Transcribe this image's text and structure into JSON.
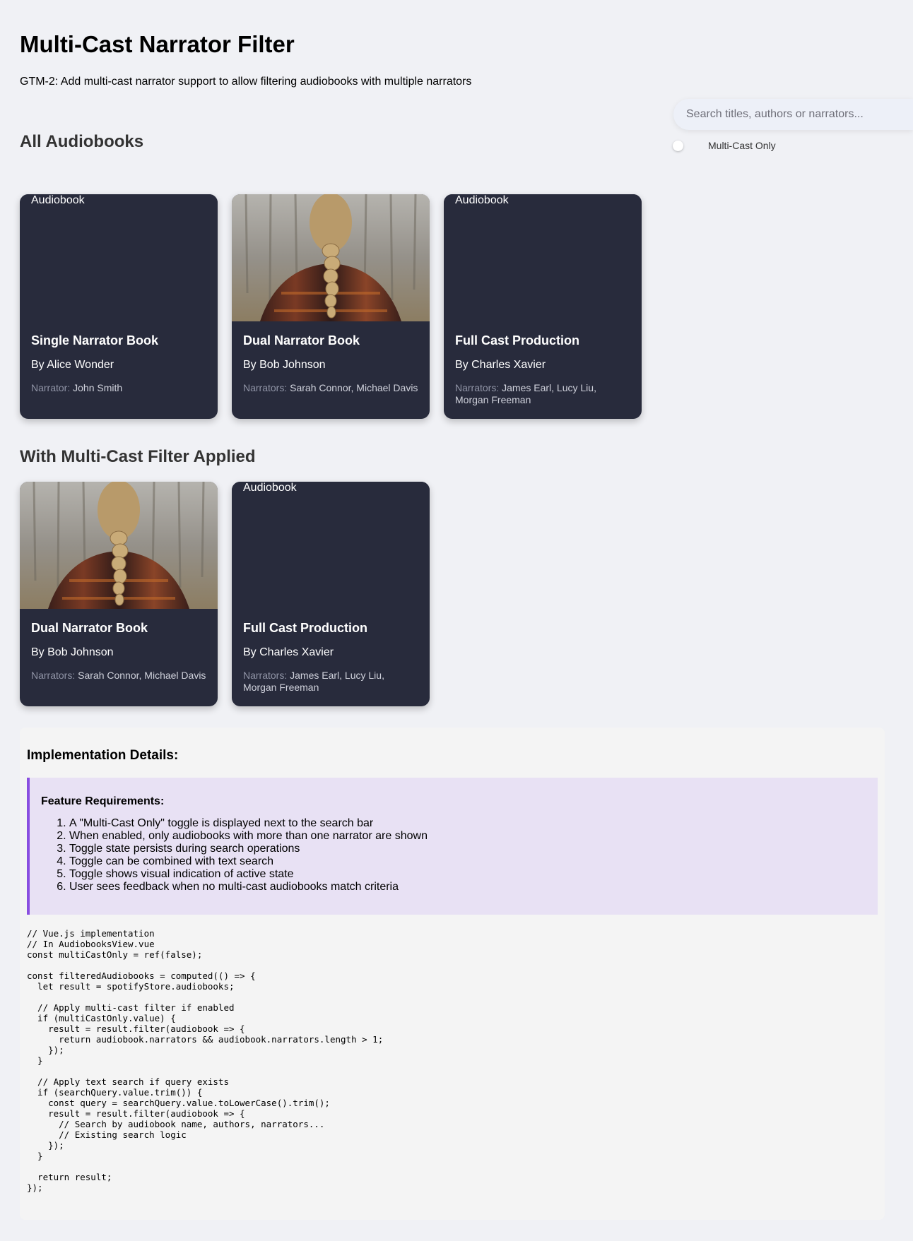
{
  "header": {
    "title": "Multi-Cast Narrator Filter",
    "subtitle": "GTM-2: Add multi-cast narrator support to allow filtering audiobooks with multiple narrators"
  },
  "search": {
    "placeholder": "Search titles, authors or narrators...",
    "value": ""
  },
  "toggle": {
    "label": "Multi-Cast Only",
    "active": false
  },
  "sections": {
    "all_heading": "All Audiobooks",
    "filtered_heading": "With Multi-Cast Filter Applied"
  },
  "all_books": [
    {
      "image_alt": "Audiobook",
      "image": "broken",
      "title": "Single Narrator Book",
      "author": "By Alice Wonder",
      "narrators_label": "Narrator:",
      "narrators": "John Smith"
    },
    {
      "image_alt": "Audiobook",
      "image": "braided-hair-photo",
      "title": "Dual Narrator Book",
      "author": "By Bob Johnson",
      "narrators_label": "Narrators:",
      "narrators": "Sarah Connor, Michael Davis"
    },
    {
      "image_alt": "Audiobook",
      "image": "broken",
      "title": "Full Cast Production",
      "author": "By Charles Xavier",
      "narrators_label": "Narrators:",
      "narrators": "James Earl, Lucy Liu, Morgan Freeman"
    }
  ],
  "filtered_books": [
    {
      "image_alt": "Audiobook",
      "image": "braided-hair-photo",
      "title": "Dual Narrator Book",
      "author": "By Bob Johnson",
      "narrators_label": "Narrators:",
      "narrators": "Sarah Connor, Michael Davis"
    },
    {
      "image_alt": "Audiobook",
      "image": "broken",
      "title": "Full Cast Production",
      "author": "By Charles Xavier",
      "narrators_label": "Narrators:",
      "narrators": "James Earl, Lucy Liu, Morgan Freeman"
    }
  ],
  "implementation": {
    "heading": "Implementation Details:",
    "requirements_heading": "Feature Requirements:",
    "requirements": [
      "A \"Multi-Cast Only\" toggle is displayed next to the search bar",
      "When enabled, only audiobooks with more than one narrator are shown",
      "Toggle state persists during search operations",
      "Toggle can be combined with text search",
      "Toggle shows visual indication of active state",
      "User sees feedback when no multi-cast audiobooks match criteria"
    ],
    "code": "// Vue.js implementation\n// In AudiobooksView.vue\nconst multiCastOnly = ref(false);\n\nconst filteredAudiobooks = computed(() => {\n  let result = spotifyStore.audiobooks;\n\n  // Apply multi-cast filter if enabled\n  if (multiCastOnly.value) {\n    result = result.filter(audiobook => {\n      return audiobook.narrators && audiobook.narrators.length > 1;\n    });\n  }\n\n  // Apply text search if query exists\n  if (searchQuery.value.trim()) {\n    const query = searchQuery.value.toLowerCase().trim();\n    result = result.filter(audiobook => {\n      // Search by audiobook name, authors, narrators...\n      // Existing search logic\n    });\n  }\n\n  return result;\n});"
  },
  "colors": {
    "page_bg": "#f0f1f5",
    "card_bg": "#282b3c",
    "accent_border": "#8a4fe0",
    "requirements_bg": "#e8e1f4"
  }
}
